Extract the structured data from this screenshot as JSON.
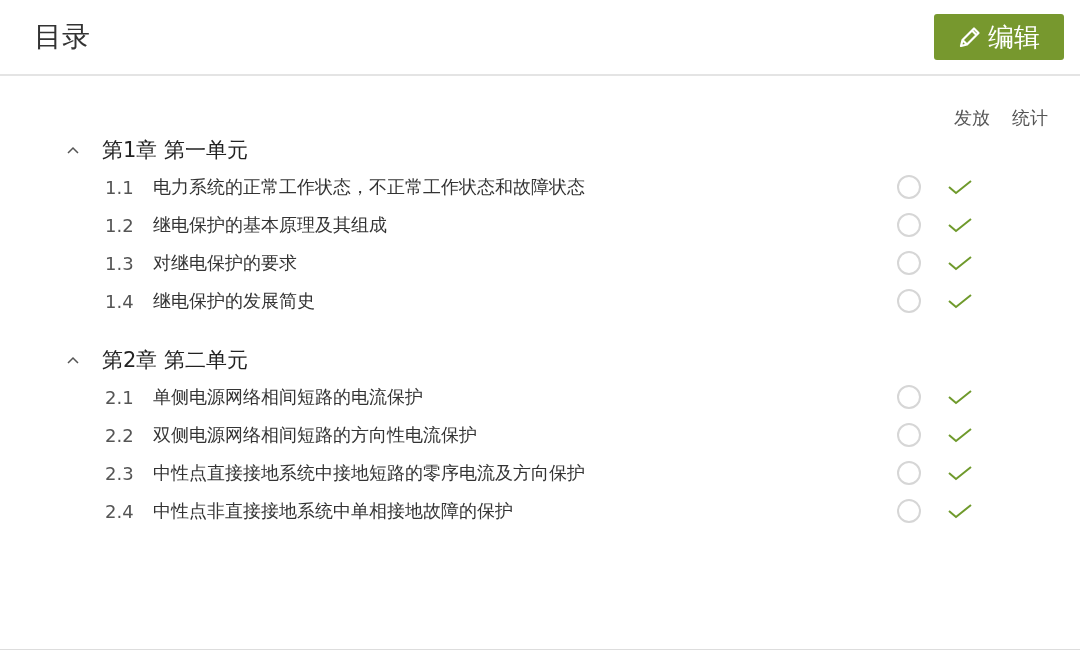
{
  "header": {
    "title": "目录",
    "edit_button": "编辑"
  },
  "columns": [
    "发放",
    "统计"
  ],
  "chapters": [
    {
      "title": "第1章 第一单元",
      "expanded": true,
      "sections": [
        {
          "number": "1.1",
          "title": "电力系统的正常工作状态，不正常工作状态和故障状态",
          "released": false,
          "stats": true
        },
        {
          "number": "1.2",
          "title": "继电保护的基本原理及其组成",
          "released": false,
          "stats": true
        },
        {
          "number": "1.3",
          "title": "对继电保护的要求",
          "released": false,
          "stats": true
        },
        {
          "number": "1.4",
          "title": "继电保护的发展简史",
          "released": false,
          "stats": true
        }
      ]
    },
    {
      "title": "第2章 第二单元",
      "expanded": true,
      "sections": [
        {
          "number": "2.1",
          "title": "单侧电源网络相间短路的电流保护",
          "released": false,
          "stats": true
        },
        {
          "number": "2.2",
          "title": "双侧电源网络相间短路的方向性电流保护",
          "released": false,
          "stats": true
        },
        {
          "number": "2.3",
          "title": "中性点直接接地系统中接地短路的零序电流及方向保护",
          "released": false,
          "stats": true
        },
        {
          "number": "2.4",
          "title": "中性点非直接接地系统中单相接地故障的保护",
          "released": false,
          "stats": true
        }
      ]
    }
  ]
}
